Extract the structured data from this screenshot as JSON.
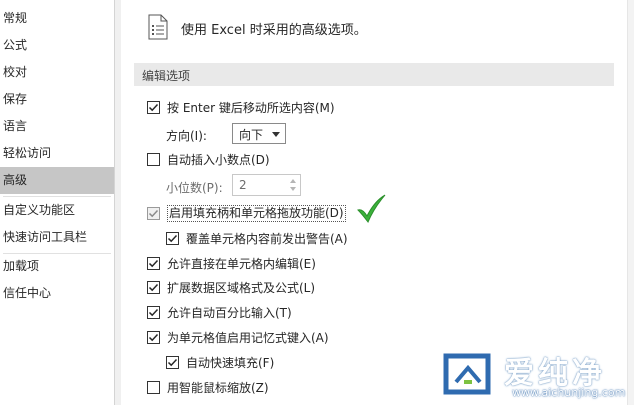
{
  "sidebar": {
    "items": [
      {
        "label": "常规"
      },
      {
        "label": "公式"
      },
      {
        "label": "校对"
      },
      {
        "label": "保存"
      },
      {
        "label": "语言"
      },
      {
        "label": "轻松访问"
      },
      {
        "label": "高级",
        "active": true
      },
      {
        "label": "自定义功能区"
      },
      {
        "label": "快速访问工具栏"
      },
      {
        "label": "加载项"
      },
      {
        "label": "信任中心"
      }
    ]
  },
  "header": {
    "text": "使用 Excel 时采用的高级选项。",
    "icon": "document-list-icon"
  },
  "section": {
    "title": "编辑选项"
  },
  "options": {
    "move_after_enter": {
      "label": "按 Enter 键后移动所选内容(M)",
      "checked": true
    },
    "direction": {
      "label": "方向(I):",
      "value": "向下"
    },
    "auto_decimal": {
      "label": "自动插入小数点(D)",
      "checked": false
    },
    "places": {
      "label": "小位数(P):",
      "value": "2"
    },
    "fill_handle": {
      "label": "启用填充柄和单元格拖放功能(D)",
      "checked": true,
      "disabled": true
    },
    "alert_overwrite": {
      "label": "覆盖单元格内容前发出警告(A)",
      "checked": true
    },
    "edit_in_cell": {
      "label": "允许直接在单元格内编辑(E)",
      "checked": true
    },
    "extend_formats": {
      "label": "扩展数据区域格式及公式(L)",
      "checked": true
    },
    "auto_percent": {
      "label": "允许自动百分比输入(T)",
      "checked": true
    },
    "autocomplete": {
      "label": "为单元格值启用记忆式键入(A)",
      "checked": true
    },
    "flash_fill": {
      "label": "自动快速填充(F)",
      "checked": true
    },
    "intellimouse_zoom": {
      "label": "用智能鼠标缩放(Z)",
      "checked": false
    }
  },
  "annotation": {
    "icon": "green-checkmark-icon",
    "color": "#3bb13b"
  },
  "watermark": {
    "brand": "爱纯净",
    "url": "www.aichunjing.com"
  }
}
